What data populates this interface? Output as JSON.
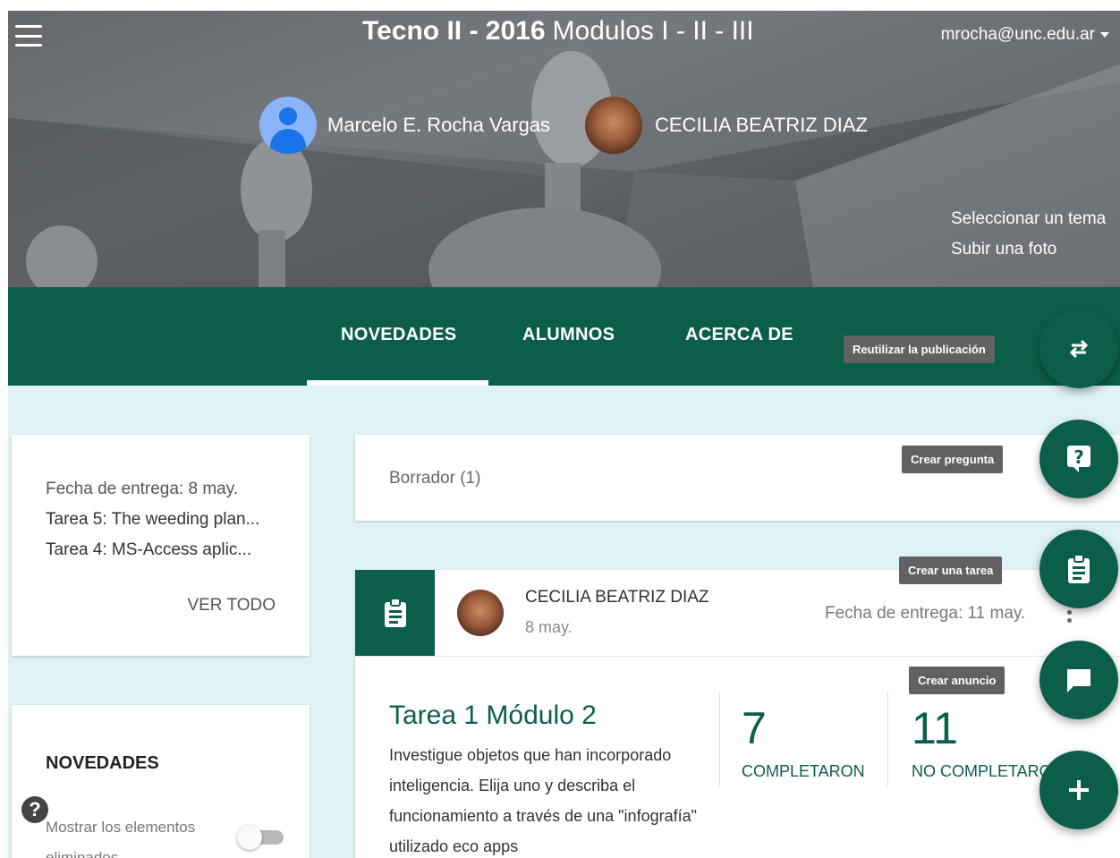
{
  "header": {
    "course_name": "Tecno II - 2016",
    "course_section": "Modulos I - II - III",
    "account": "mrocha@unc.edu.ar"
  },
  "teachers": [
    {
      "name": "Marcelo E. Rocha Vargas"
    },
    {
      "name": "CECILIA BEATRIZ DIAZ"
    }
  ],
  "banner_links": {
    "select_theme": "Seleccionar un tema",
    "upload_photo": "Subir una foto"
  },
  "tabs": [
    {
      "label": "NOVEDADES",
      "active": true
    },
    {
      "label": "ALUMNOS",
      "active": false
    },
    {
      "label": "ACERCA DE",
      "active": false
    }
  ],
  "fab_tooltips": {
    "reuse": "Reutilizar la publicación",
    "question": "Crear pregunta",
    "task": "Crear una tarea",
    "announcement": "Crear anuncio"
  },
  "upcoming": {
    "due_label": "Fecha de entrega: 8 may.",
    "items": [
      "Tarea 5: The weeding plan...",
      "Tarea 4: MS-Access aplic..."
    ],
    "view_all": "VER TODO"
  },
  "sidebar_news": {
    "heading": "NOVEDADES",
    "toggle_label": "Mostrar los elementos eliminados",
    "toggle_on": false
  },
  "draft": {
    "label": "Borrador (1)"
  },
  "post": {
    "author": "CECILIA BEATRIZ DIAZ",
    "date": "8 may.",
    "due": "Fecha de entrega: 11 may.",
    "title": "Tarea 1 Módulo 2",
    "description": "Investigue objetos que han incorporado inteligencia. Elija uno y describa el funcionamiento a través de una \"infografía\" utilizado eco apps",
    "completed_count": "7",
    "completed_label": "COMPLETARON",
    "not_completed_count": "11",
    "not_completed_label": "NO COMPLETARON"
  },
  "colors": {
    "primary": "#0b5e4a",
    "background": "#dff3f6",
    "tooltip": "#616161"
  },
  "icons": [
    "menu-icon",
    "caret-down-icon",
    "repost-icon",
    "question-icon",
    "assignment-icon",
    "chat-icon",
    "plus-icon",
    "help-icon",
    "more-vert-icon"
  ]
}
